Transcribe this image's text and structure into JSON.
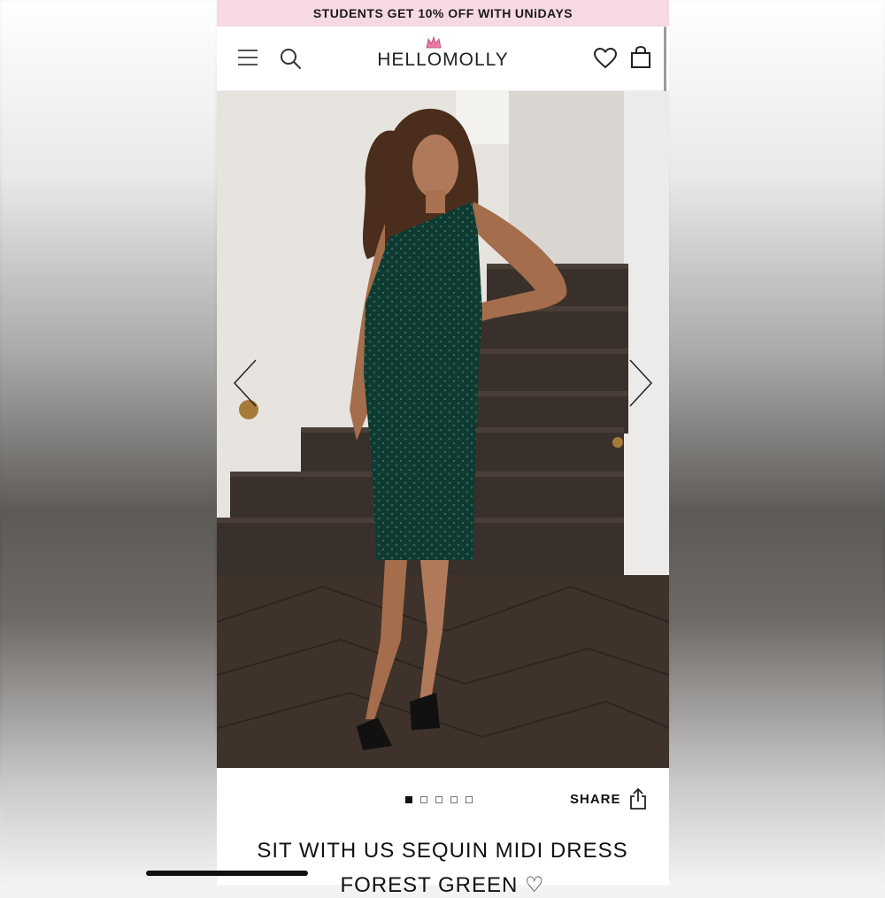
{
  "promo": {
    "text": "STUDENTS GET 10% OFF WITH",
    "brand": "UNiDAYS"
  },
  "header": {
    "logo_text": "HELLOMOLLY",
    "icons": [
      "menu-icon",
      "search-icon",
      "heart-icon",
      "shopping-bag-icon"
    ]
  },
  "gallery": {
    "image_count": 5,
    "active_index": 0
  },
  "actions": {
    "share_label": "SHARE"
  },
  "product": {
    "title_line1": "SIT WITH US SEQUIN MIDI DRESS",
    "title_line2": "FOREST GREEN ♡"
  },
  "colors": {
    "promo_bg": "#f6d9e1",
    "dress": "#0f3a31",
    "text": "#111111"
  }
}
